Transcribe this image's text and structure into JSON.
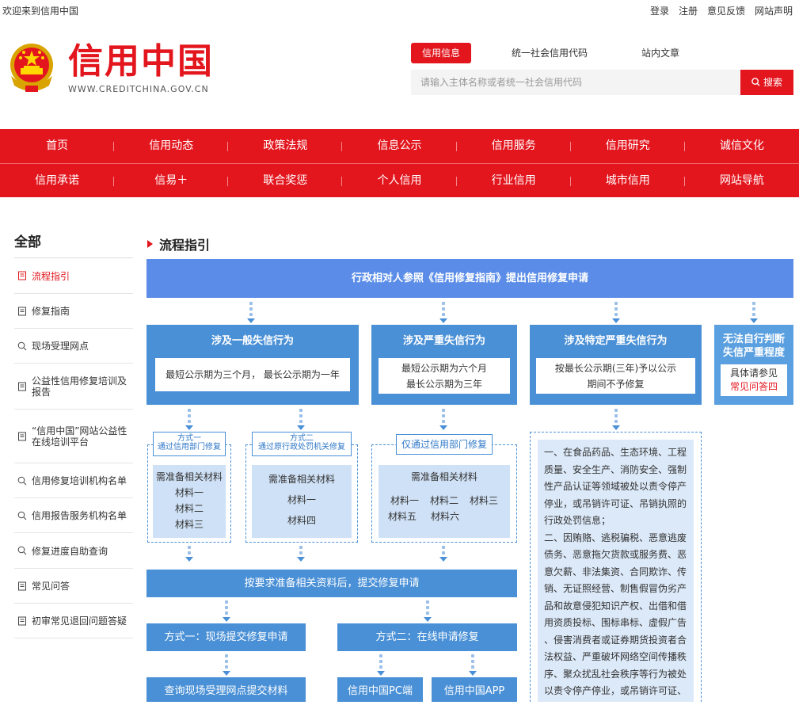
{
  "topbar": {
    "welcome": "欢迎来到信用中国",
    "links": [
      "登录",
      "注册",
      "意见反馈",
      "网站声明"
    ]
  },
  "brand": {
    "name": "信用中国",
    "url": "WWW.CREDITCHINA.GOV.CN",
    "logo_icon": "national-emblem-icon"
  },
  "search": {
    "tabs": [
      "信用信息",
      "统一社会信用代码",
      "站内文章"
    ],
    "active_tab": 0,
    "placeholder": "请输入主体名称或者统一社会信用代码",
    "button": "搜索"
  },
  "nav": {
    "row1": [
      "首页",
      "信用动态",
      "政策法规",
      "信息公示",
      "信用服务",
      "信用研究",
      "诚信文化"
    ],
    "row2": [
      "信用承诺",
      "信易＋",
      "联合奖惩",
      "个人信用",
      "行业信用",
      "城市信用",
      "网站导航"
    ]
  },
  "sidebar": {
    "title": "全部",
    "items": [
      {
        "label": "流程指引",
        "icon": "document-icon",
        "active": true
      },
      {
        "label": "修复指南",
        "icon": "document-icon"
      },
      {
        "label": "现场受理网点",
        "icon": "search-icon"
      },
      {
        "label": "公益性信用修复培训及报告",
        "icon": "document-icon"
      },
      {
        "label": "“信用中国”网站公益性在线培训平台",
        "icon": "document-icon"
      },
      {
        "label": "信用修复培训机构名单",
        "icon": "search-icon"
      },
      {
        "label": "信用报告服务机构名单",
        "icon": "search-icon"
      },
      {
        "label": "修复进度自助查询",
        "icon": "search-icon"
      },
      {
        "label": "常见问答",
        "icon": "document-icon"
      },
      {
        "label": "初审常见退回问题答疑",
        "icon": "document-icon"
      }
    ]
  },
  "main": {
    "title": "流程指引"
  },
  "flow": {
    "top": "行政相对人参照《信用修复指南》提出信用修复申请",
    "c1": {
      "title": "涉及一般失信行为",
      "desc": "最短公示期为三个月， 最长公示期为一年",
      "m1": {
        "tag1": "方式一",
        "tag2": "通过信用部门修复",
        "head": "需准备相关材料",
        "items": [
          "材料一",
          "材料二",
          "材料三"
        ]
      },
      "m2": {
        "tag1": "方式二",
        "tag2": "通过原行政处罚机关修复",
        "head": "需准备相关材料",
        "items": [
          "材料一",
          "材料四"
        ]
      }
    },
    "c2": {
      "title": "涉及严重失信行为",
      "desc1": "最短公示期为六个月",
      "desc2": "最长公示期为三年",
      "tag": "仅通过信用部门修复",
      "head": "需准备相关材料",
      "items": [
        "材料一",
        "材料二",
        "材料三",
        "材料五",
        "材料六"
      ]
    },
    "c3": {
      "title": "涉及特定严重失信行为",
      "desc1": "按最长公示期(三年)予以公示",
      "desc2": "期间不予修复",
      "text": [
        "一、在食品药品、生态环境、工程",
        "质量、安全生产、消防安全、强制",
        "性产品认证等领域被处以责令停产",
        "停业，或吊销许可证、吊销执照的",
        "行政处罚信息；",
        "二、因贿赂、逃税骗税、恶意逃废",
        "债务、恶意拖欠货款或服务费、恶",
        "意欠薪、非法集资、合同欺诈、传",
        "销、无证照经营、制售假冒伪劣产",
        "品和故意侵犯知识产权、出借和借",
        "用资质投标、围标串标、虚假广告",
        "、侵害消费者或证券期货投资者合",
        "法权益、严重破坏网络空间传播秩",
        "序、聚众扰乱社会秩序等行为被处",
        "以责令停产停业，或吊销许可证、"
      ]
    },
    "c4": {
      "title1": "无法自行判断",
      "title2": "失信严重程度",
      "desc1": "具体请参见",
      "desc2": "常见问答四"
    },
    "submit": "按要求准备相关资料后，提交修复申请",
    "way1": "方式一：现场提交修复申请",
    "way2": "方式二：在线申请修复",
    "way1_sub": "查询现场受理网点提交材料",
    "pc": "信用中国PC端",
    "app": "信用中国APP"
  }
}
